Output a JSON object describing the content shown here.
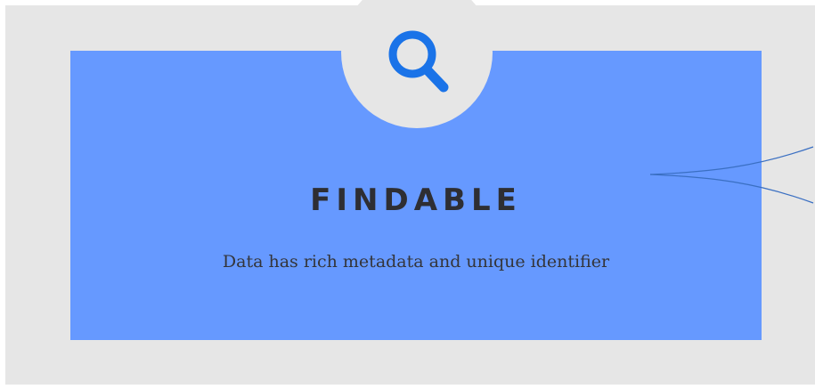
{
  "card": {
    "title": "FINDABLE",
    "description": "Data has rich metadata and unique identifier",
    "icon": "search-icon"
  },
  "colors": {
    "background": "#e6e6e6",
    "card": "#6699ff",
    "icon": "#1a73e8",
    "connector": "#3a6fc2",
    "title": "#2e2e33"
  }
}
